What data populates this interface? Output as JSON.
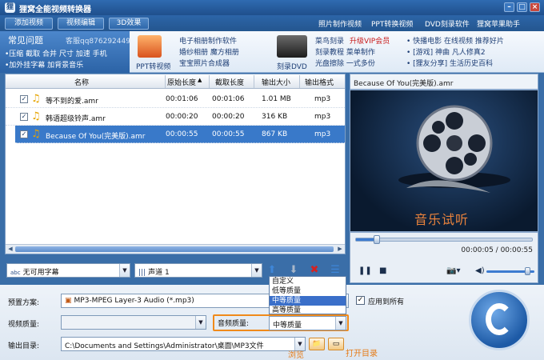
{
  "window": {
    "title": "狸窝全能视频转换器"
  },
  "toolbar": {
    "add_video": "添加视频",
    "edit_video": "视频编辑",
    "effect_3d": "3D效果",
    "links": [
      "照片制作视频",
      "PPT转换视频",
      "DVD刻录软件",
      "狸窝苹果助手"
    ]
  },
  "promo": {
    "faq_title": "常见问题",
    "qq": "客服qq876292449",
    "faq_line1": "•压缩  截取  合并  尺寸  加速  手机",
    "faq_line2": "•加外挂字幕  加背景音乐",
    "ppt_label": "PPT转视频",
    "col1": [
      "电子相册制作软件",
      "婚纱相册  魔方相册",
      "宝宝照片合成器"
    ],
    "dvd_label": "刻录DVD",
    "col2a": "菜鸟刻录",
    "col2_vip": "升级VIP会员",
    "col2b": "刻录教程  菜单制作",
    "col2c": "光盘擦除  一式多份",
    "col3a": "• 快播电影  在线视频  推荐好片",
    "col3b": "• [游戏] 神曲  凡人修真2",
    "col3c": "• [狸友分享] 生活历史百科"
  },
  "table": {
    "headers": [
      "名称",
      "原始长度",
      "截取长度",
      "输出大小",
      "输出格式"
    ],
    "rows": [
      {
        "name": "等不到的爱.amr",
        "orig": "00:01:06",
        "cut": "00:01:06",
        "size": "1.01 MB",
        "format": "mp3"
      },
      {
        "name": "韩语超级铃声.amr",
        "orig": "00:00:20",
        "cut": "00:00:20",
        "size": "316 KB",
        "format": "mp3"
      },
      {
        "name": "Because Of You(完美版).amr",
        "orig": "00:00:55",
        "cut": "00:00:55",
        "size": "867 KB",
        "format": "mp3"
      }
    ]
  },
  "preview": {
    "title": "Because Of You(完美版).amr",
    "overlay": "音乐试听",
    "time": "00:00:05 / 00:00:55"
  },
  "controls": {
    "subtitle": "无可用字幕",
    "audio_track": "声道 1"
  },
  "quality_dropdown": {
    "options": [
      "自定义",
      "低等质量",
      "中等质量",
      "高等质量"
    ],
    "selected_index": 2
  },
  "bottom": {
    "preset_label": "预置方案:",
    "preset_value": "MP3-MPEG Layer-3 Audio (*.mp3)",
    "apply_all": "应用到所有",
    "video_quality_label": "视频质量:",
    "audio_quality_label": "音频质量:",
    "audio_quality_value": "中等质量",
    "output_dir_label": "输出目录:",
    "output_dir_value": "C:\\Documents and Settings\\Administrator\\桌面\\MP3文件",
    "browse": "浏览",
    "open_dir": "打开目录"
  },
  "colors": {
    "accent": "#3979c9",
    "highlight": "#f08a1b"
  }
}
